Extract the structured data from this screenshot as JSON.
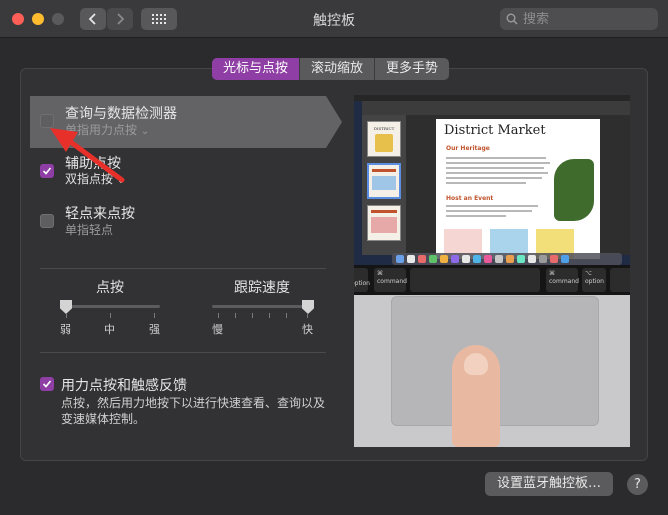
{
  "window": {
    "title": "触控板"
  },
  "search": {
    "placeholder": "搜索"
  },
  "tabs": [
    {
      "label": "光标与点按",
      "active": true
    },
    {
      "label": "滚动缩放",
      "active": false
    },
    {
      "label": "更多手势",
      "active": false
    }
  ],
  "options": [
    {
      "title": "查询与数据检测器",
      "subtitle": "单指用力点按",
      "checked": false,
      "selected": true
    },
    {
      "title": "辅助点按",
      "subtitle": "双指点按",
      "checked": true,
      "selected": false
    },
    {
      "title": "轻点来点按",
      "subtitle": "单指轻点",
      "checked": false,
      "selected": false
    }
  ],
  "click_slider": {
    "title": "点按",
    "labels": [
      "弱",
      "中",
      "强"
    ],
    "value_fraction": 0.0
  },
  "tracking_slider": {
    "title": "跟踪速度",
    "labels": [
      "慢",
      "快"
    ],
    "value_fraction": 1.0
  },
  "force_click": {
    "title": "用力点按和触感反馈",
    "checked": true,
    "description": "点按，然后用力地按下以进行快速查看、查询以及变速媒体控制。"
  },
  "preview": {
    "doc_title": "District Market",
    "doc_heading1": "Our Heritage",
    "doc_heading2": "Host an Event",
    "thumb_label": "DISTRICT",
    "keys": {
      "option": "option",
      "command": "command",
      "cmd_symbol": "⌘",
      "opt_symbol": "⌥"
    }
  },
  "bottom": {
    "bluetooth_button": "设置蓝牙触控板…",
    "help": "?"
  },
  "colors": {
    "accent": "#8e3ea4",
    "annotation": "#e8302a"
  }
}
